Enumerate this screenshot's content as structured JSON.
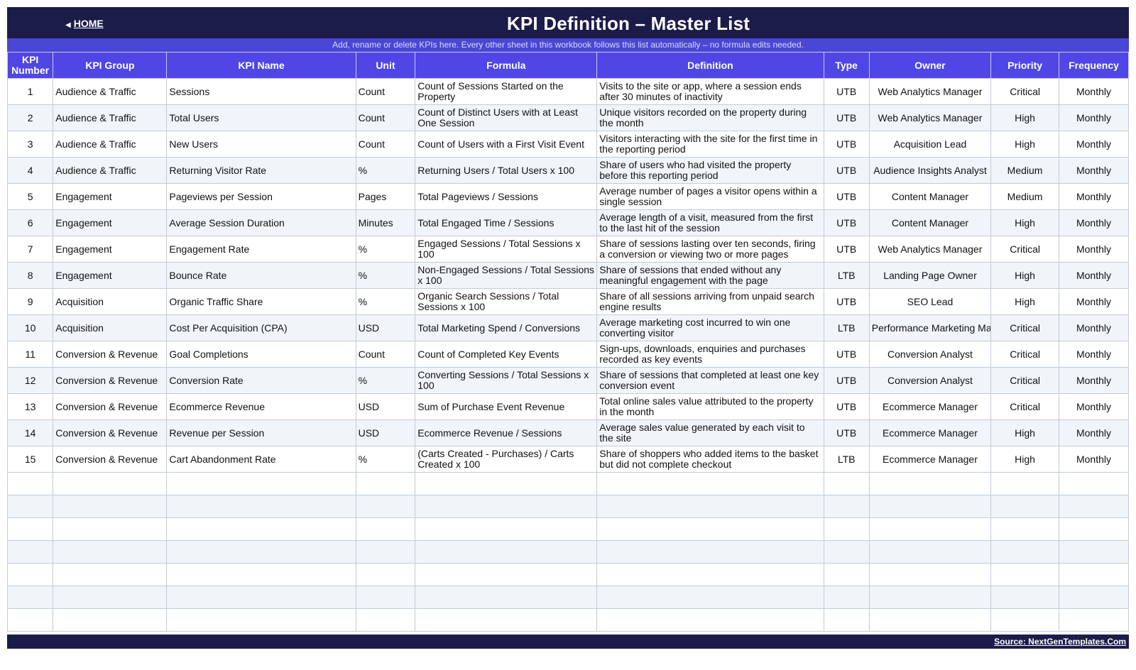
{
  "header": {
    "home_label": "HOME",
    "title": "KPI Definition  –  Master List",
    "subtitle": "Add, rename or delete KPIs here. Every other sheet in this workbook follows this list automatically – no formula edits needed."
  },
  "table": {
    "columns": [
      "KPI Number",
      "KPI Group",
      "KPI Name",
      "Unit",
      "Formula",
      "Definition",
      "Type",
      "Owner",
      "Priority",
      "Frequency"
    ],
    "rows": [
      [
        "1",
        "Audience & Traffic",
        "Sessions",
        "Count",
        "Count of Sessions Started on the Property",
        "Visits to the site or app, where a session ends after 30 minutes of inactivity",
        "UTB",
        "Web Analytics Manager",
        "Critical",
        "Monthly"
      ],
      [
        "2",
        "Audience & Traffic",
        "Total Users",
        "Count",
        "Count of Distinct Users with at Least One Session",
        "Unique visitors recorded on the property during the month",
        "UTB",
        "Web Analytics Manager",
        "High",
        "Monthly"
      ],
      [
        "3",
        "Audience & Traffic",
        "New Users",
        "Count",
        "Count of Users with a First Visit Event",
        "Visitors interacting with the site for the first time in the reporting period",
        "UTB",
        "Acquisition Lead",
        "High",
        "Monthly"
      ],
      [
        "4",
        "Audience & Traffic",
        "Returning Visitor Rate",
        "%",
        "Returning Users / Total Users x 100",
        "Share of users who had visited the property before this reporting period",
        "UTB",
        "Audience Insights Analyst",
        "Medium",
        "Monthly"
      ],
      [
        "5",
        "Engagement",
        "Pageviews per Session",
        "Pages",
        "Total Pageviews / Sessions",
        "Average number of pages a visitor opens within a single session",
        "UTB",
        "Content Manager",
        "Medium",
        "Monthly"
      ],
      [
        "6",
        "Engagement",
        "Average Session Duration",
        "Minutes",
        "Total Engaged Time / Sessions",
        "Average length of a visit, measured from the first to the last hit of the session",
        "UTB",
        "Content Manager",
        "High",
        "Monthly"
      ],
      [
        "7",
        "Engagement",
        "Engagement Rate",
        "%",
        "Engaged Sessions / Total Sessions x 100",
        "Share of sessions lasting over ten seconds, firing a conversion or viewing two or more pages",
        "UTB",
        "Web Analytics Manager",
        "Critical",
        "Monthly"
      ],
      [
        "8",
        "Engagement",
        "Bounce Rate",
        "%",
        "Non-Engaged Sessions / Total Sessions x 100",
        "Share of sessions that ended without any meaningful engagement with the page",
        "LTB",
        "Landing Page Owner",
        "High",
        "Monthly"
      ],
      [
        "9",
        "Acquisition",
        "Organic Traffic Share",
        "%",
        "Organic Search Sessions / Total Sessions x 100",
        "Share of all sessions arriving from unpaid search engine results",
        "UTB",
        "SEO Lead",
        "High",
        "Monthly"
      ],
      [
        "10",
        "Acquisition",
        "Cost Per Acquisition (CPA)",
        "USD",
        "Total Marketing Spend / Conversions",
        "Average marketing cost incurred to win one converting visitor",
        "LTB",
        "Performance Marketing Manager",
        "Critical",
        "Monthly"
      ],
      [
        "11",
        "Conversion & Revenue",
        "Goal Completions",
        "Count",
        "Count of Completed Key Events",
        "Sign-ups, downloads, enquiries and purchases recorded as key events",
        "UTB",
        "Conversion Analyst",
        "Critical",
        "Monthly"
      ],
      [
        "12",
        "Conversion & Revenue",
        "Conversion Rate",
        "%",
        "Converting Sessions / Total Sessions x 100",
        "Share of sessions that completed at least one key conversion event",
        "UTB",
        "Conversion Analyst",
        "Critical",
        "Monthly"
      ],
      [
        "13",
        "Conversion & Revenue",
        "Ecommerce Revenue",
        "USD",
        "Sum of Purchase Event Revenue",
        "Total online sales value attributed to the property in the month",
        "UTB",
        "Ecommerce Manager",
        "Critical",
        "Monthly"
      ],
      [
        "14",
        "Conversion & Revenue",
        "Revenue per Session",
        "USD",
        "Ecommerce Revenue / Sessions",
        "Average sales value generated by each visit to the site",
        "UTB",
        "Ecommerce Manager",
        "High",
        "Monthly"
      ],
      [
        "15",
        "Conversion & Revenue",
        "Cart Abandonment Rate",
        "%",
        "(Carts Created - Purchases) / Carts Created x 100",
        "Share of shoppers who added items to the basket but did not complete checkout",
        "LTB",
        "Ecommerce Manager",
        "High",
        "Monthly"
      ]
    ]
  },
  "footer": {
    "source_label": "Source: NextGenTemplates.Com"
  },
  "colors": {
    "title_bar": "#1c1c4a",
    "subtitle_bar": "#4a47d6",
    "header_row": "#4f46e5",
    "alt_row": "#f1f5f9"
  }
}
